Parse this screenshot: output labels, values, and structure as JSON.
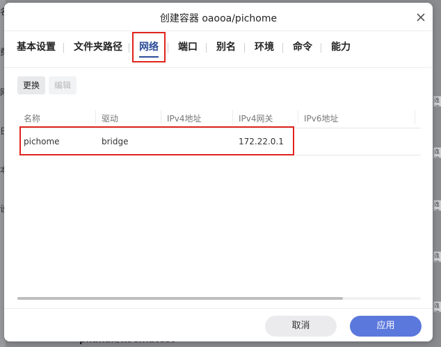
{
  "dialog": {
    "title": "创建容器 oaooa/pichome",
    "tabs": [
      {
        "label": "基本设置"
      },
      {
        "label": "文件夹路径"
      },
      {
        "label": "网络",
        "active": true
      },
      {
        "label": "端口"
      },
      {
        "label": "别名"
      },
      {
        "label": "环境"
      },
      {
        "label": "命令"
      },
      {
        "label": "能力"
      }
    ],
    "toolbar": {
      "change_label": "更换",
      "edit_label": "编辑"
    },
    "table": {
      "headers": [
        "名称",
        "驱动",
        "IPv4地址",
        "IPv4网关",
        "IPv6地址"
      ],
      "rows": [
        {
          "name": "pichome",
          "driver": "bridge",
          "ipv4": "",
          "gateway": "172.22.0.1",
          "ipv6": ""
        }
      ]
    },
    "footer": {
      "cancel_label": "取消",
      "apply_label": "应用"
    }
  },
  "background": {
    "left_chars": [
      "名",
      "费",
      "网",
      "日",
      "本",
      "设"
    ],
    "right_labels": [
      "连接",
      "连接",
      "连接",
      "连接",
      "连接",
      "连接"
    ],
    "bottom_text": "phanan/koel:latest"
  },
  "colors": {
    "accent": "#2b4c98",
    "apply_button": "#5b78dc",
    "highlight_box": "#e0231c"
  },
  "icons": {
    "close": "close-icon"
  }
}
